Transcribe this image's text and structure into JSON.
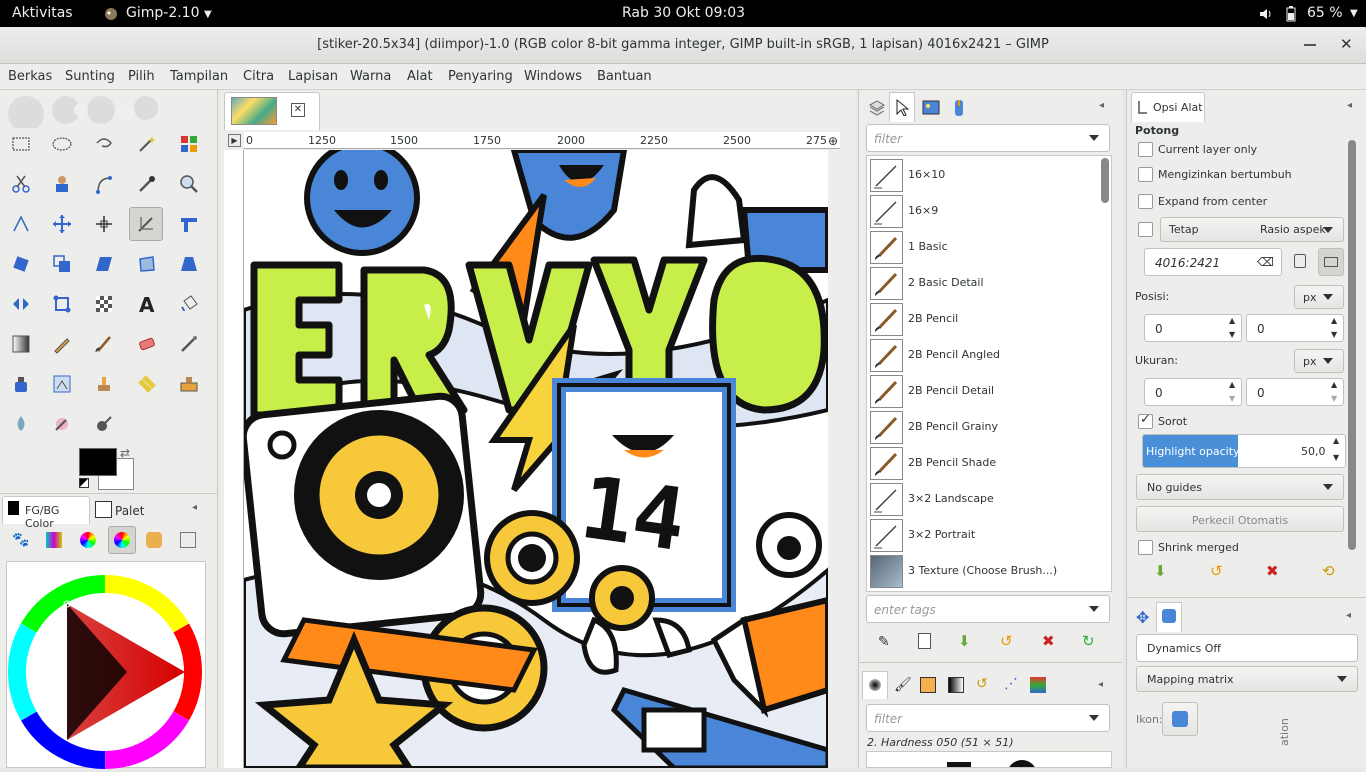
{
  "topbar": {
    "activities": "Aktivitas",
    "app_menu": "Gimp-2.10",
    "clock": "Rab 30 Okt  09:03",
    "battery": "65 %"
  },
  "window": {
    "title": "[stiker-20.5x34] (diimpor)-1.0 (RGB color 8-bit gamma integer, GIMP built-in sRGB, 1 lapisan) 4016x2421 – GIMP"
  },
  "menu": [
    "Berkas",
    "Sunting",
    "Pilih",
    "Tampilan",
    "Citra",
    "Lapisan",
    "Warna",
    "Alat",
    "Penyaring",
    "Windows",
    "Bantuan"
  ],
  "toolbox": {
    "tab_fgbg": "FG/BG Color",
    "tab_palet": "Palet",
    "colors": {
      "fg": "#000000",
      "bg": "#ffffff"
    }
  },
  "ruler": {
    "ticks": [
      "0",
      "1250",
      "1500",
      "1750",
      "2000",
      "2250",
      "2500",
      "275"
    ]
  },
  "brushes": {
    "filter_placeholder": "filter",
    "items": [
      "16×10",
      "16×9",
      "1 Basic",
      "2 Basic Detail",
      "2B Pencil",
      "2B Pencil Angled",
      "2B Pencil Detail",
      "2B Pencil Grainy",
      "2B Pencil Shade",
      "3×2 Landscape",
      "3×2 Portrait",
      "3 Texture (Choose Brush...)"
    ],
    "tags_placeholder": "enter tags"
  },
  "lower_dock": {
    "filter_placeholder": "filter",
    "brush_info": "2. Hardness 050 (51 × 51)"
  },
  "tool_options": {
    "tab": "Opsi Alat",
    "section": "Potong",
    "current_layer_only": "Current layer only",
    "allow_growing": "Mengizinkan bertumbuh",
    "expand_center": "Expand from center",
    "fixed": "Tetap",
    "aspect": "Rasio aspek",
    "ratio_value": "4016:2421",
    "position_label": "Posisi:",
    "unit": "px",
    "pos_x": "0",
    "pos_y": "0",
    "size_label": "Ukuran:",
    "size_unit": "px",
    "size_w": "0",
    "size_h": "0",
    "highlight": "Sorot",
    "highlight_opacity_label": "Highlight opacity",
    "highlight_opacity_value": "50,0",
    "highlight_opacity_fill": 0.5,
    "guides": "No guides",
    "autoshrink": "Perkecil Otomatis",
    "shrink_merged": "Shrink merged"
  },
  "device_status": {
    "dynamics": "Dynamics Off",
    "mapping": "Mapping matrix",
    "icon_label": "Ikon:",
    "vertical_label": "ation"
  }
}
